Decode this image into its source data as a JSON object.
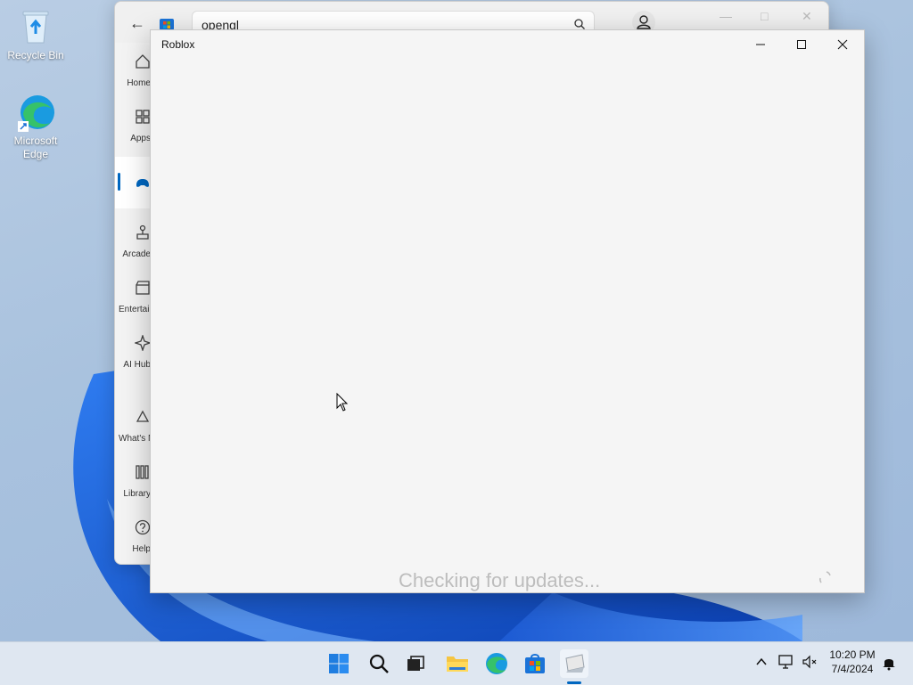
{
  "desktop": {
    "icons": [
      {
        "label": "Recycle Bin",
        "icon": "recycle-bin-icon"
      },
      {
        "label": "Microsoft Edge",
        "icon": "edge-icon"
      }
    ]
  },
  "store": {
    "search_value": "opengl",
    "nav": [
      {
        "label": "Home",
        "icon": "home-icon"
      },
      {
        "label": "Apps",
        "icon": "apps-icon"
      },
      {
        "label": "Gaming",
        "icon": "gamepad-icon"
      },
      {
        "label": "Arcade",
        "icon": "arcade-icon"
      },
      {
        "label": "Entertainment",
        "icon": "clapperboard-icon"
      },
      {
        "label": "AI Hub",
        "icon": "sparkle-icon"
      },
      {
        "label": "What's New",
        "icon": "bell-shape-icon"
      },
      {
        "label": "Library",
        "icon": "library-icon"
      },
      {
        "label": "Help",
        "icon": "help-icon"
      }
    ]
  },
  "roblox": {
    "title": "Roblox",
    "status": "Checking for updates..."
  },
  "taskbar": {
    "apps": [
      "start-icon",
      "search-icon",
      "task-view-icon",
      "file-explorer-icon",
      "edge-icon",
      "store-icon",
      "roblox-icon"
    ],
    "time": "10:20 PM",
    "date": "7/4/2024"
  },
  "colors": {
    "accent": "#0067c0",
    "status_text": "#bdbdbd"
  }
}
